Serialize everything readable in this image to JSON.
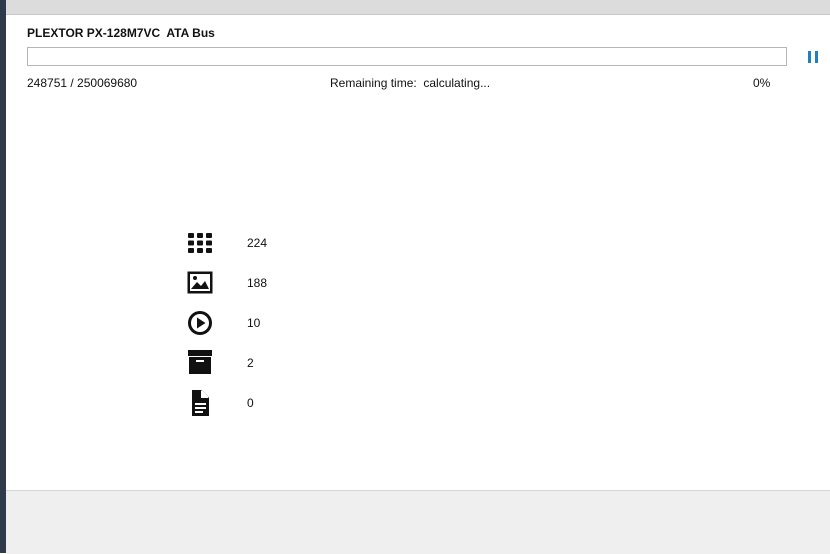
{
  "device": {
    "title": "PLEXTOR PX-128M7VC  ATA Bus"
  },
  "progress": {
    "sectors": "248751 / 250069680",
    "remaining_label": "Remaining time:  calculating...",
    "percent_text": "0%",
    "percent_value": 0,
    "fill_color": "#4a9fd6"
  },
  "controls": {
    "pause_icon": "pause-icon",
    "pause_color": "#1e7fc3"
  },
  "stats": [
    {
      "icon": "grid-icon",
      "count": "224"
    },
    {
      "icon": "image-icon",
      "count": "188"
    },
    {
      "icon": "play-circle-icon",
      "count": "10"
    },
    {
      "icon": "archive-icon",
      "count": "2"
    },
    {
      "icon": "document-icon",
      "count": "0"
    }
  ]
}
